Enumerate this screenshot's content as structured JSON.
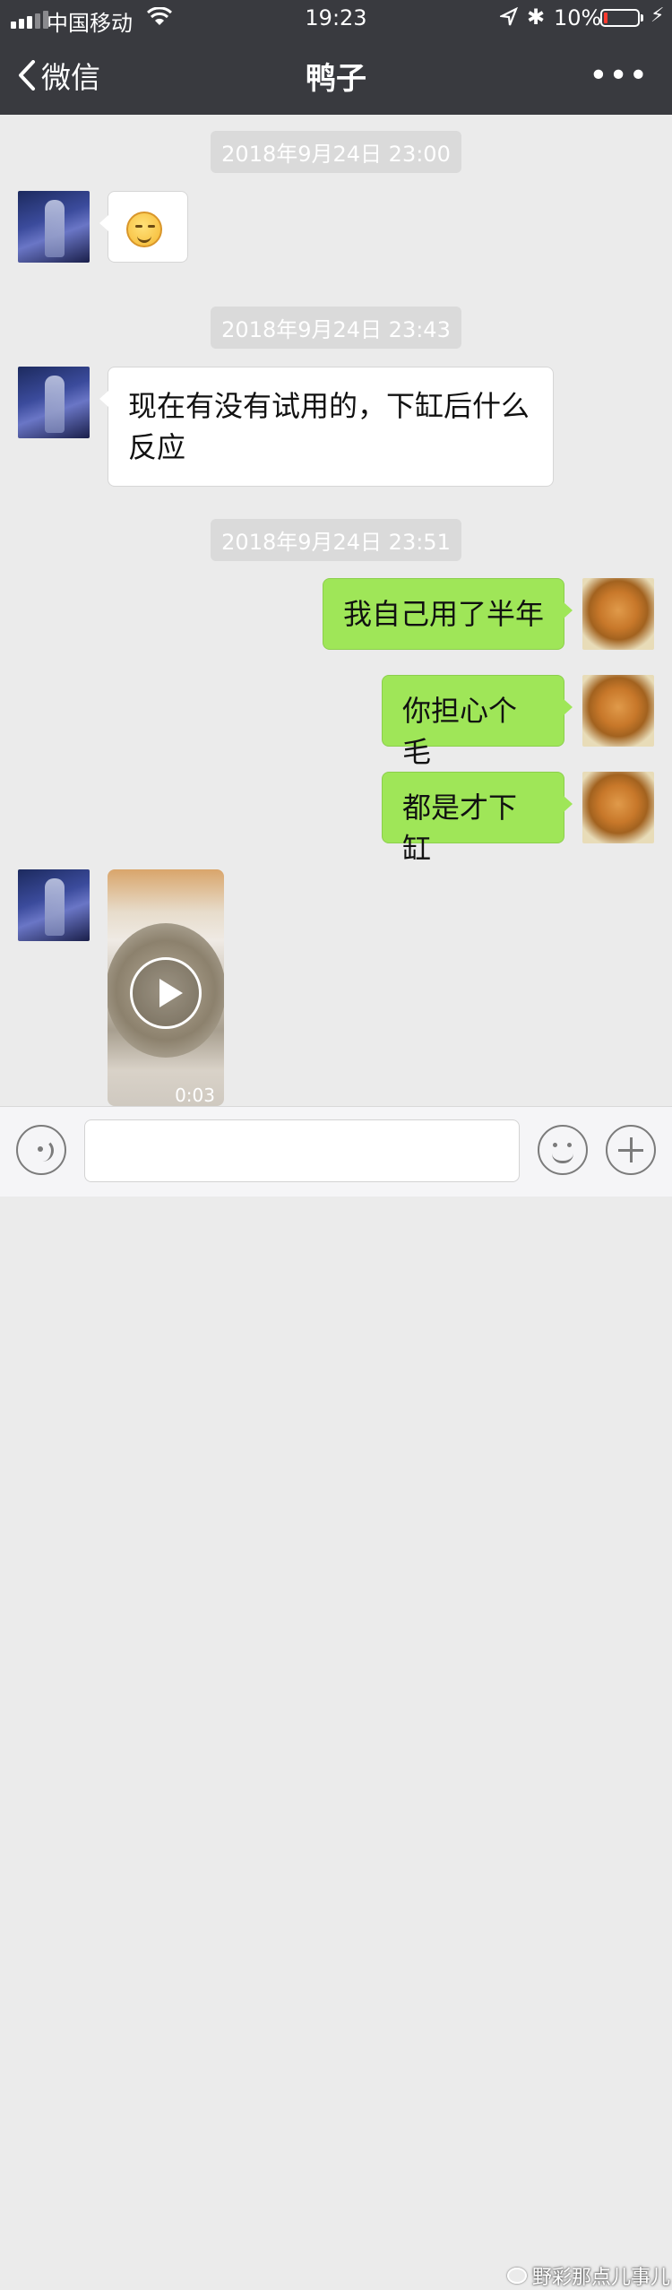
{
  "status_bar": {
    "carrier": "中国移动",
    "time": "19:23",
    "battery_percent": "10%",
    "battery_level": 0.1,
    "bluetooth_glyph": "✱",
    "charging_glyph": "⚡"
  },
  "nav": {
    "back_label": "微信",
    "title": "鸭子",
    "more_label": "•••"
  },
  "messages": [
    {
      "type": "timestamp",
      "text": "2018年9月24日 23:00"
    },
    {
      "type": "emoji",
      "side": "left",
      "icon": "smirk-emoji-icon"
    },
    {
      "type": "timestamp",
      "text": "2018年9月24日 23:43"
    },
    {
      "type": "text",
      "side": "left",
      "text": "现在有没有试用的，下缸后什么反应"
    },
    {
      "type": "timestamp",
      "text": "2018年9月24日 23:51"
    },
    {
      "type": "text",
      "side": "right",
      "text": "我自己用了半年"
    },
    {
      "type": "text",
      "side": "right",
      "text": "你担心个毛"
    },
    {
      "type": "text",
      "side": "right",
      "text": "都是才下缸"
    },
    {
      "type": "video",
      "side": "left",
      "duration": "0:03"
    }
  ],
  "input_bar": {
    "voice_icon": "voice-icon",
    "emoji_icon": "emoji-icon",
    "plus_icon": "plus-icon"
  },
  "watermark": "野彩那点儿事儿",
  "colors": {
    "nav_bg": "#393a3f",
    "chat_bg": "#ebebeb",
    "bubble_right": "#9fe658",
    "bubble_left": "#ffffff"
  }
}
